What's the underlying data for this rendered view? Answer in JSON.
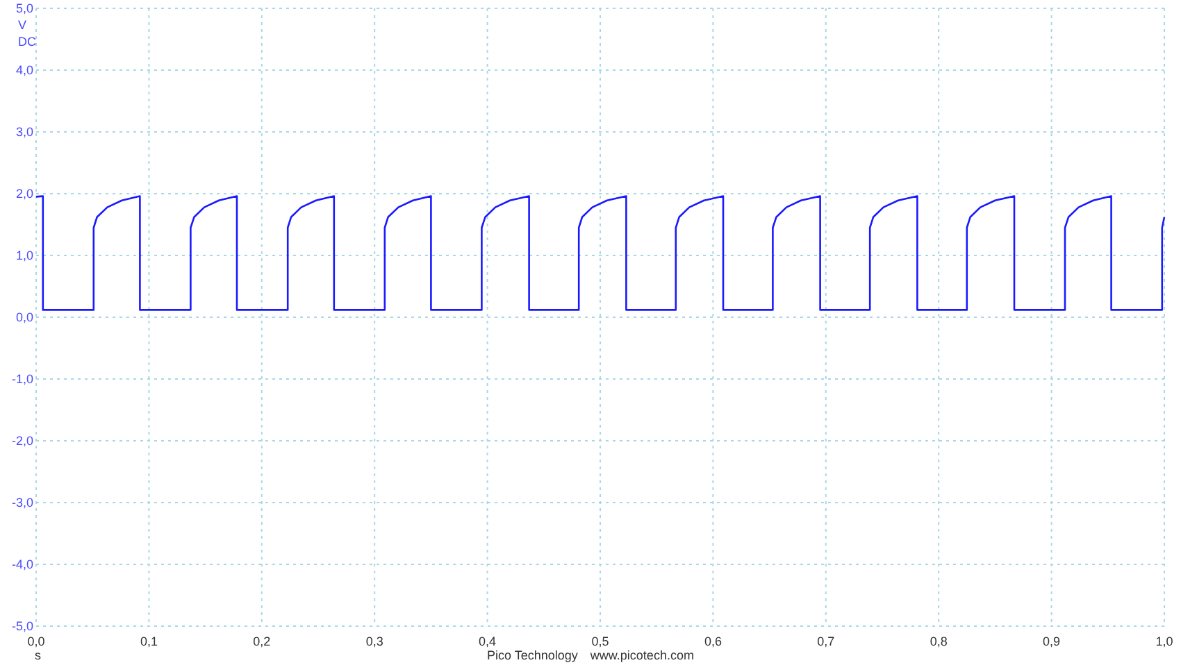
{
  "chart_data": {
    "type": "line",
    "grid": true,
    "ylabel": "V",
    "xlabel": "s",
    "xlim": [
      0,
      1
    ],
    "ylim": [
      -5,
      5
    ],
    "xticks": [
      {
        "value": 0,
        "label": "0,0"
      },
      {
        "value": 0.1,
        "label": "0,1"
      },
      {
        "value": 0.2,
        "label": "0,2"
      },
      {
        "value": 0.3,
        "label": "0,3"
      },
      {
        "value": 0.4,
        "label": "0,4"
      },
      {
        "value": 0.5,
        "label": "0,5"
      },
      {
        "value": 0.6,
        "label": "0,6"
      },
      {
        "value": 0.7,
        "label": "0,7"
      },
      {
        "value": 0.8,
        "label": "0,8"
      },
      {
        "value": 0.9,
        "label": "0,9"
      },
      {
        "value": 1,
        "label": "1,0"
      }
    ],
    "yticks": [
      {
        "value": 5,
        "label": "5,0"
      },
      {
        "value": 4,
        "label": "4,0"
      },
      {
        "value": 3,
        "label": "3,0"
      },
      {
        "value": 2,
        "label": "2,0"
      },
      {
        "value": 1,
        "label": "1,0"
      },
      {
        "value": 0,
        "label": "0,0"
      },
      {
        "value": -1,
        "label": "-1,0"
      },
      {
        "value": -2,
        "label": "-2,0"
      },
      {
        "value": -3,
        "label": "-3,0"
      },
      {
        "value": -4,
        "label": "-4,0"
      },
      {
        "value": -5,
        "label": "-5,0"
      }
    ],
    "x": [
      0,
      0.006,
      0.006,
      0.051,
      0.051,
      0.054,
      0.063,
      0.076,
      0.092,
      0.092,
      0.137,
      0.137,
      0.14,
      0.149,
      0.162,
      0.178,
      0.178,
      0.223,
      0.223,
      0.226,
      0.235,
      0.248,
      0.264,
      0.264,
      0.309,
      0.309,
      0.312,
      0.321,
      0.334,
      0.35,
      0.35,
      0.395,
      0.395,
      0.398,
      0.407,
      0.42,
      0.437,
      0.437,
      0.481,
      0.481,
      0.484,
      0.493,
      0.506,
      0.523,
      0.523,
      0.567,
      0.567,
      0.57,
      0.579,
      0.592,
      0.609,
      0.609,
      0.653,
      0.653,
      0.656,
      0.665,
      0.678,
      0.695,
      0.695,
      0.739,
      0.739,
      0.742,
      0.751,
      0.764,
      0.781,
      0.781,
      0.825,
      0.825,
      0.828,
      0.837,
      0.85,
      0.867,
      0.867,
      0.912,
      0.912,
      0.915,
      0.924,
      0.937,
      0.953,
      0.953,
      0.998,
      0.998,
      1
    ],
    "series": [
      {
        "color": "#1a1aff",
        "values": [
          1.95,
          1.96,
          0.12,
          0.12,
          1.45,
          1.62,
          1.78,
          1.89,
          1.96,
          0.12,
          0.12,
          1.45,
          1.62,
          1.78,
          1.89,
          1.96,
          0.12,
          0.12,
          1.45,
          1.62,
          1.78,
          1.89,
          1.96,
          0.12,
          0.12,
          1.45,
          1.62,
          1.78,
          1.89,
          1.96,
          0.12,
          0.12,
          1.45,
          1.62,
          1.78,
          1.89,
          1.96,
          0.12,
          0.12,
          1.45,
          1.62,
          1.78,
          1.89,
          1.96,
          0.12,
          0.12,
          1.45,
          1.62,
          1.78,
          1.89,
          1.96,
          0.12,
          0.12,
          1.45,
          1.62,
          1.78,
          1.89,
          1.96,
          0.12,
          0.12,
          1.45,
          1.62,
          1.78,
          1.89,
          1.96,
          0.12,
          0.12,
          1.45,
          1.62,
          1.78,
          1.89,
          1.96,
          0.12,
          0.12,
          1.45,
          1.62,
          1.78,
          1.89,
          1.96,
          0.12,
          0.12,
          1.45,
          1.62
        ]
      }
    ]
  },
  "coupling": "DC",
  "footer": {
    "company": "Pico Technology",
    "website": "www.picotech.com"
  }
}
